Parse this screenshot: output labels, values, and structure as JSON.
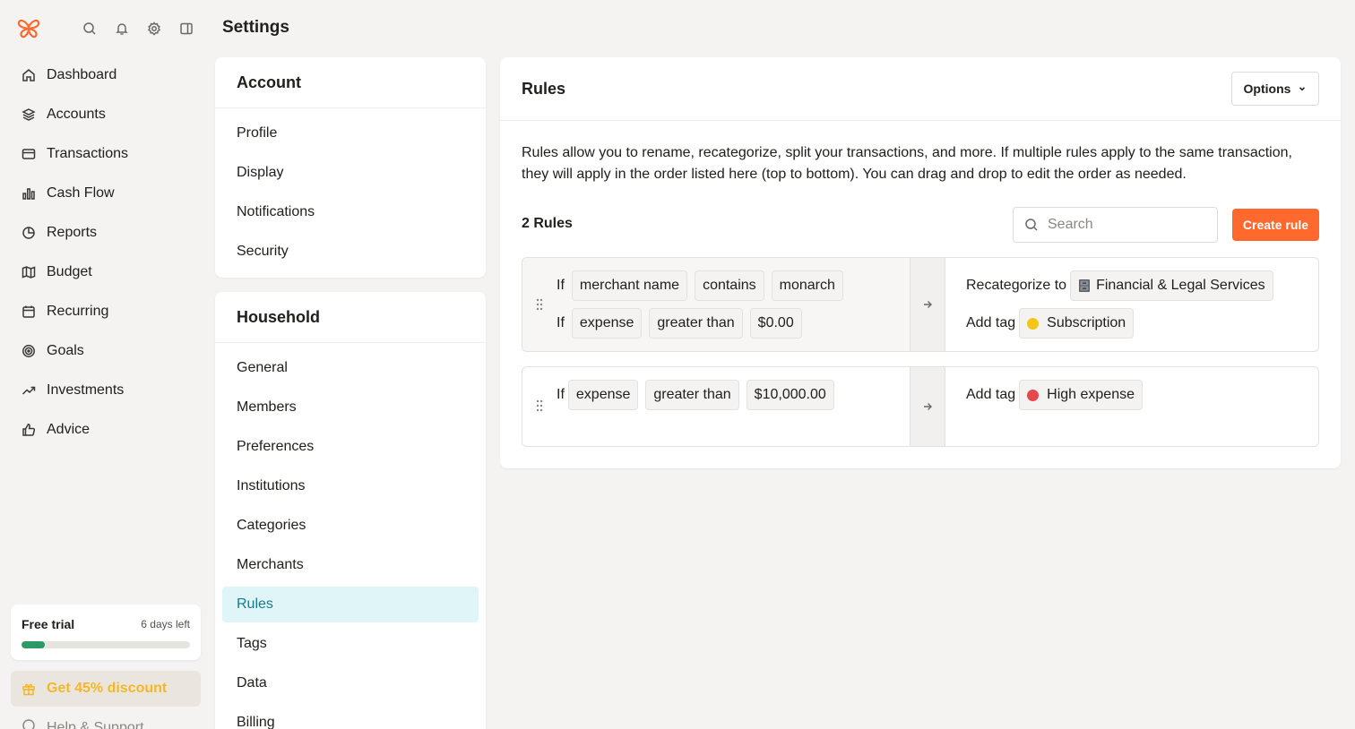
{
  "sidebar": {
    "nav": [
      {
        "label": "Dashboard",
        "icon": "home-icon"
      },
      {
        "label": "Accounts",
        "icon": "layers-icon"
      },
      {
        "label": "Transactions",
        "icon": "credit-card-icon"
      },
      {
        "label": "Cash Flow",
        "icon": "bar-chart-icon"
      },
      {
        "label": "Reports",
        "icon": "pie-chart-icon"
      },
      {
        "label": "Budget",
        "icon": "map-icon"
      },
      {
        "label": "Recurring",
        "icon": "calendar-icon"
      },
      {
        "label": "Goals",
        "icon": "target-icon"
      },
      {
        "label": "Investments",
        "icon": "trending-up-icon"
      },
      {
        "label": "Advice",
        "icon": "thumbs-up-icon"
      }
    ],
    "trial": {
      "title": "Free trial",
      "days_left": "6 days left",
      "progress": 0.14,
      "bar_color": "#2b9a66"
    },
    "discount_label": "Get 45% discount",
    "help_label": "Help & Support"
  },
  "header": {
    "title": "Settings"
  },
  "settings_menu": {
    "account": {
      "title": "Account",
      "items": [
        "Profile",
        "Display",
        "Notifications",
        "Security"
      ]
    },
    "household": {
      "title": "Household",
      "items": [
        "General",
        "Members",
        "Preferences",
        "Institutions",
        "Categories",
        "Merchants",
        "Rules",
        "Tags",
        "Data",
        "Billing"
      ],
      "active": "Rules"
    }
  },
  "rules": {
    "title": "Rules",
    "options_label": "Options",
    "description": "Rules allow you to rename, recategorize, split your transactions, and more. If multiple rules apply to the same transaction, they will apply in the order listed here (top to bottom). You can drag and drop to edit the order as needed.",
    "count_label": "2 Rules",
    "search_placeholder": "Search",
    "create_label": "Create rule",
    "if_word": "If",
    "list": [
      {
        "conditions": [
          {
            "field": "merchant name",
            "op": "contains",
            "value": "monarch"
          },
          {
            "field": "expense",
            "op": "greater than",
            "value": "$0.00"
          }
        ],
        "actions": [
          {
            "label": "Recategorize to",
            "value": "Financial & Legal Services",
            "icon": "file-cabinet-icon"
          },
          {
            "label": "Add tag",
            "value": "Subscription",
            "color": "#f5c518"
          }
        ]
      },
      {
        "conditions": [
          {
            "field": "expense",
            "op": "greater than",
            "value": "$10,000.00"
          }
        ],
        "actions": [
          {
            "label": "Add tag",
            "value": "High expense",
            "color": "#e5484d"
          }
        ]
      }
    ]
  },
  "colors": {
    "accent": "#ff692d",
    "active_bg": "#dff5f7",
    "active_text": "#137d8d",
    "discount_text": "#f5b727"
  }
}
